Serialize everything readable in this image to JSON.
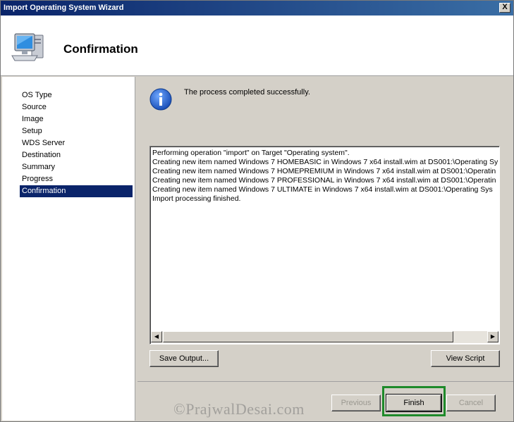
{
  "window": {
    "title": "Import Operating System Wizard",
    "close_label": "X"
  },
  "header": {
    "title": "Confirmation",
    "icon": "computer-icon"
  },
  "sidebar": {
    "items": [
      {
        "label": "OS Type"
      },
      {
        "label": "Source"
      },
      {
        "label": "Image"
      },
      {
        "label": "Setup"
      },
      {
        "label": "WDS Server"
      },
      {
        "label": "Destination"
      },
      {
        "label": "Summary"
      },
      {
        "label": "Progress"
      },
      {
        "label": "Confirmation",
        "active": true
      }
    ]
  },
  "main": {
    "status_icon": "info-icon",
    "status_text": "The process completed successfully.",
    "output_lines": [
      "Performing operation \"import\" on Target \"Operating system\".",
      "Creating new item named Windows 7 HOMEBASIC in Windows 7 x64 install.wim at DS001:\\Operating Sy",
      "Creating new item named Windows 7 HOMEPREMIUM in Windows 7 x64 install.wim at DS001:\\Operatin",
      "Creating new item named Windows 7 PROFESSIONAL in Windows 7 x64 install.wim at DS001:\\Operatin",
      "Creating new item named Windows 7 ULTIMATE in Windows 7 x64 install.wim at DS001:\\Operating Sys",
      "Import processing finished."
    ],
    "save_output_label": "Save Output...",
    "view_script_label": "View Script"
  },
  "footer": {
    "previous_label": "Previous",
    "finish_label": "Finish",
    "cancel_label": "Cancel"
  },
  "watermark": "©PrajwalDesai.com",
  "colors": {
    "selection": "#0a246a",
    "highlight_border": "#1e8a2a",
    "dialog_bg": "#d4d0c8"
  }
}
